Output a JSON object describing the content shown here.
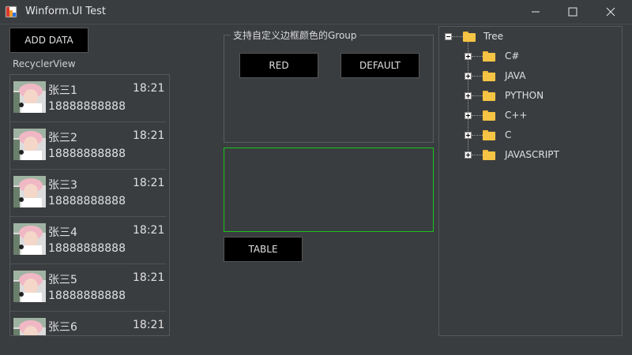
{
  "window": {
    "title": "Winform.UI Test",
    "controls": [
      "minimize-icon",
      "maximize-icon",
      "close-icon"
    ]
  },
  "left": {
    "add_button": "ADD DATA",
    "list_label": "RecyclerView",
    "items": [
      {
        "name": "张三1",
        "time": "18:21",
        "phone": "18888888888"
      },
      {
        "name": "张三2",
        "time": "18:21",
        "phone": "18888888888"
      },
      {
        "name": "张三3",
        "time": "18:21",
        "phone": "18888888888"
      },
      {
        "name": "张三4",
        "time": "18:21",
        "phone": "18888888888"
      },
      {
        "name": "张三5",
        "time": "18:21",
        "phone": "18888888888"
      },
      {
        "name": "张三6",
        "time": "18:21",
        "phone": ""
      }
    ]
  },
  "middle": {
    "group_title": "支持自定义边框颜色的Group",
    "red_button": "RED",
    "default_button": "DEFAULT",
    "table_button": "TABLE"
  },
  "tree": {
    "root": "Tree",
    "children": [
      "C#",
      "JAVA",
      "PYTHON",
      "C++",
      "C",
      "JAVASCRIPT"
    ]
  },
  "colors": {
    "background": "#3a3d40",
    "button": "#000000",
    "group_border_accent": "#19c419",
    "folder": "#f6c444"
  }
}
